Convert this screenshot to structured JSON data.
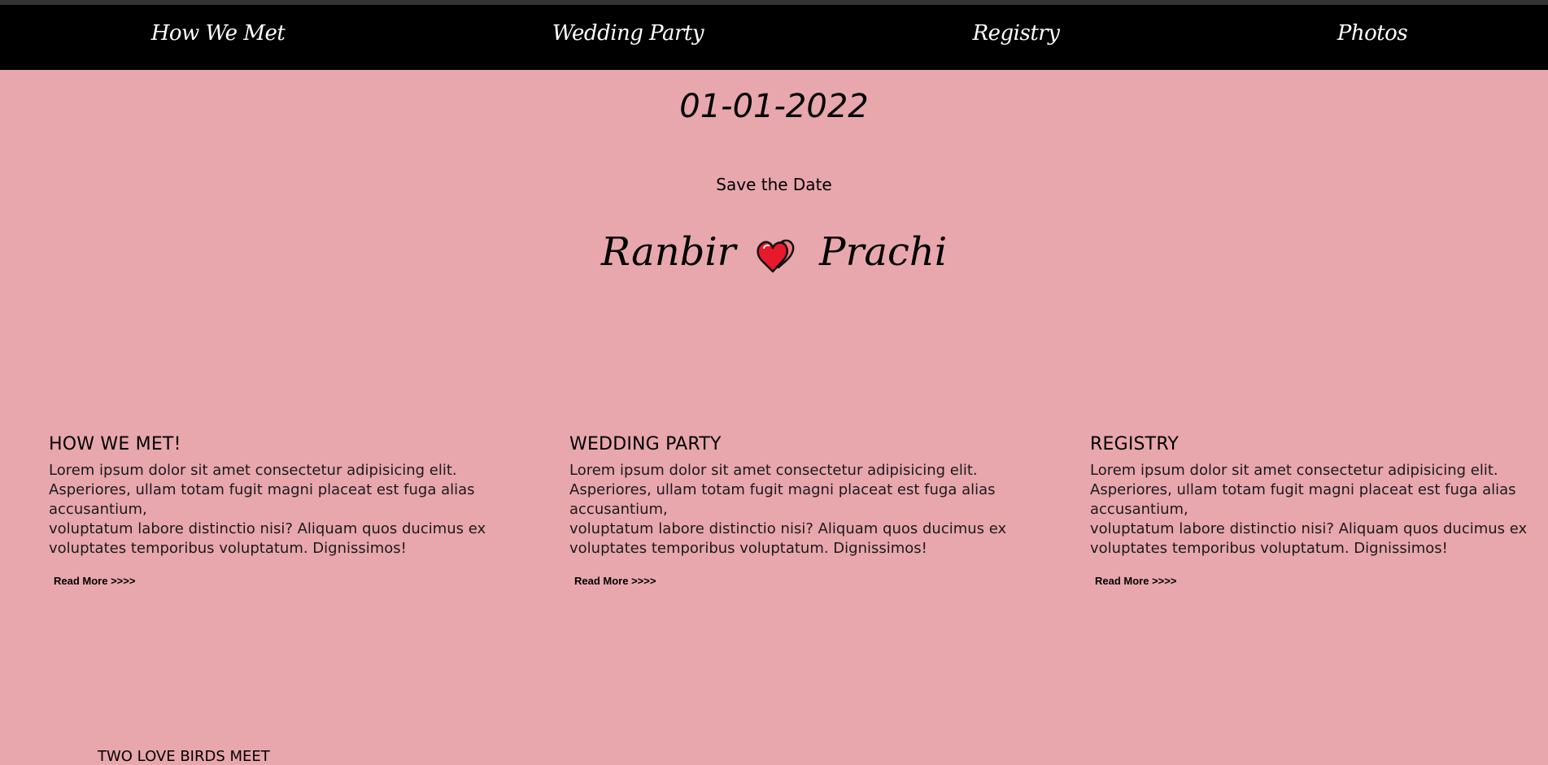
{
  "nav": {
    "items": [
      {
        "label": "How We Met"
      },
      {
        "label": "Wedding Party"
      },
      {
        "label": "Registry"
      },
      {
        "label": "Photos"
      }
    ]
  },
  "hero": {
    "date": "01-01-2022",
    "subtitle": "Save the Date",
    "name_left": "Ranbir",
    "name_right": "Prachi",
    "heart_icon": "double-heart-icon"
  },
  "cards": [
    {
      "title": "HOW WE MET!",
      "text_line1": "Lorem ipsum dolor sit amet consectetur adipisicing elit. Asperiores, ullam totam fugit magni placeat est fuga alias accusantium,",
      "text_line2": "voluptatum labore distinctio nisi? Aliquam quos ducimus ex voluptates temporibus voluptatum. Dignissimos!",
      "read_more": "Read More >>>>"
    },
    {
      "title": "WEDDING PARTY",
      "text_line1": "Lorem ipsum dolor sit amet consectetur adipisicing elit. Asperiores, ullam totam fugit magni placeat est fuga alias accusantium,",
      "text_line2": "voluptatum labore distinctio nisi? Aliquam quos ducimus ex voluptates temporibus voluptatum. Dignissimos!",
      "read_more": "Read More >>>>"
    },
    {
      "title": "REGISTRY",
      "text_line1": "Lorem ipsum dolor sit amet consectetur adipisicing elit. Asperiores, ullam totam fugit magni placeat est fuga alias accusantium,",
      "text_line2": "voluptatum labore distinctio nisi? Aliquam quos ducimus ex voluptates temporibus voluptatum. Dignissimos!",
      "read_more": "Read More >>>>"
    }
  ],
  "section": {
    "title": "TWO LOVE BIRDS MEET"
  },
  "colors": {
    "background": "#e8a7ad",
    "navbar": "#000000",
    "heart_front": "#e8192c",
    "heart_back": "#f07a84"
  }
}
